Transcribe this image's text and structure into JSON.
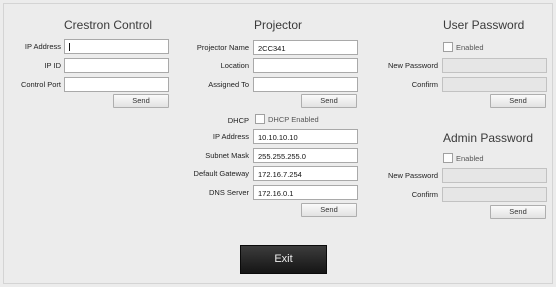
{
  "crestron": {
    "title": "Crestron Control",
    "ip_address_label": "IP Address",
    "ip_address_value": "",
    "ip_id_label": "IP ID",
    "ip_id_value": "",
    "control_port_label": "Control Port",
    "control_port_value": "",
    "send_label": "Send"
  },
  "projector": {
    "title": "Projector",
    "name_label": "Projector Name",
    "name_value": "2CC341",
    "location_label": "Location",
    "location_value": "",
    "assigned_label": "Assigned To",
    "assigned_value": "",
    "send_label": "Send",
    "dhcp_label": "DHCP",
    "dhcp_checkbox_label": "DHCP Enabled",
    "dhcp_checked": false,
    "ip_label": "IP Address",
    "ip_value": "10.10.10.10",
    "subnet_label": "Subnet Mask",
    "subnet_value": "255.255.255.0",
    "gateway_label": "Default Gateway",
    "gateway_value": "172.16.7.254",
    "dns_label": "DNS Server",
    "dns_value": "172.16.0.1",
    "network_send_label": "Send"
  },
  "user_password": {
    "title": "User Password",
    "enabled_label": "Enabled",
    "enabled_checked": false,
    "new_password_label": "New Password",
    "confirm_label": "Confirm",
    "send_label": "Send"
  },
  "admin_password": {
    "title": "Admin Password",
    "enabled_label": "Enabled",
    "enabled_checked": false,
    "new_password_label": "New Password",
    "confirm_label": "Confirm",
    "send_label": "Send"
  },
  "exit_label": "Exit"
}
